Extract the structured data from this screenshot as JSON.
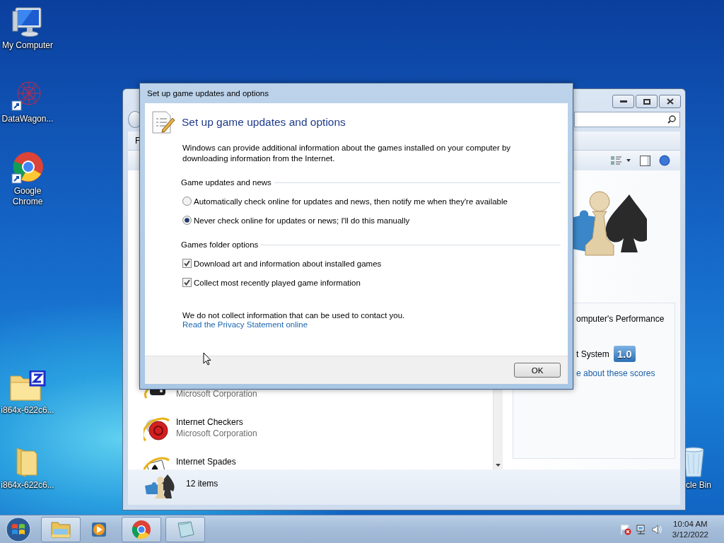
{
  "desktop_icons": [
    {
      "label": "My Computer",
      "kind": "computer"
    },
    {
      "label": "DataWagon...",
      "kind": "web-shortcut"
    },
    {
      "label": "Google Chrome",
      "kind": "chrome"
    },
    {
      "label": "i864x-622c6...",
      "kind": "zip-folder"
    },
    {
      "label": "i864x-622c6...",
      "kind": "folder"
    },
    {
      "label": "cle Bin",
      "kind": "recycle-bin"
    }
  ],
  "games_window": {
    "menu": [
      "F"
    ],
    "games": [
      {
        "publisher": "Microsoft Corporation",
        "kind": "dice"
      },
      {
        "name": "Internet Checkers",
        "publisher": "Microsoft Corporation",
        "kind": "checkers"
      },
      {
        "name": "Internet Spades",
        "kind": "spades"
      }
    ],
    "performance": {
      "heading": "omputer's Performance",
      "label": "t System",
      "score": "1.0",
      "link": "e about these scores"
    },
    "status": "12 items"
  },
  "dialog": {
    "title": "Set up game updates and options",
    "heading": "Set up game updates and options",
    "intro": "Windows can provide additional information about the games installed on your computer by downloading information from the Internet.",
    "groups": [
      {
        "label": "Game updates and news",
        "options": [
          {
            "kind": "radio",
            "label": "Automatically check online for updates and news, then notify me when they're available",
            "selected": false
          },
          {
            "kind": "radio",
            "label": "Never check online for updates or news; I'll do this manually",
            "selected": true
          }
        ]
      },
      {
        "label": "Games folder options",
        "options": [
          {
            "kind": "checkbox",
            "label": "Download art and information about installed games",
            "checked": true
          },
          {
            "kind": "checkbox",
            "label": "Collect most recently played game information",
            "checked": true
          }
        ]
      }
    ],
    "note": "We do not collect information that can be used to contact you.",
    "link": "Read the Privacy Statement online",
    "ok_button": "OK"
  },
  "taskbar": {
    "apps": [
      {
        "kind": "explorer",
        "running": true
      },
      {
        "kind": "media-player",
        "running": false
      },
      {
        "kind": "chrome",
        "running": true
      },
      {
        "kind": "notepad",
        "running": true
      }
    ],
    "time": "10:04 AM",
    "date": "3/12/2022"
  }
}
